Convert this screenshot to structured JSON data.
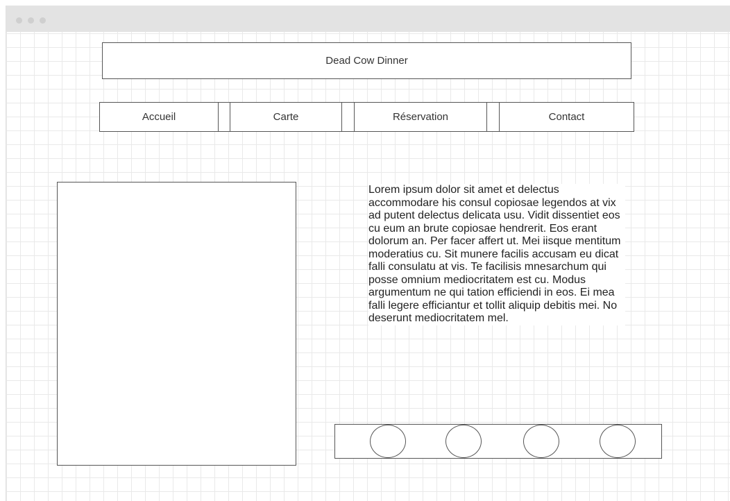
{
  "site": {
    "title": "Dead Cow Dinner"
  },
  "nav": {
    "items": [
      {
        "label": "Accueil"
      },
      {
        "label": "Carte"
      },
      {
        "label": "Réservation"
      },
      {
        "label": "Contact"
      }
    ]
  },
  "main": {
    "paragraph": "Lorem ipsum dolor sit amet et delectus accommodare his consul copiosae legendos at vix ad putent delectus delicata usu. Vidit dissentiet eos cu eum an brute copiosae hendrerit. Eos erant dolorum an. Per facer affert ut. Mei iisque mentitum moderatius cu. Sit munere facilis accusam eu dicat falli consulatu at vis. Te facilisis mnesarchum qui posse omnium mediocritatem est cu. Modus argumentum ne qui tation efficiendi in eos. Ei mea falli legere efficiantur et tollit aliquip debitis mei. No deserunt mediocritatem mel."
  },
  "colors": {
    "titlebar": "#e3e3e3",
    "grid": "#e9e9e9",
    "stroke": "#555555"
  }
}
